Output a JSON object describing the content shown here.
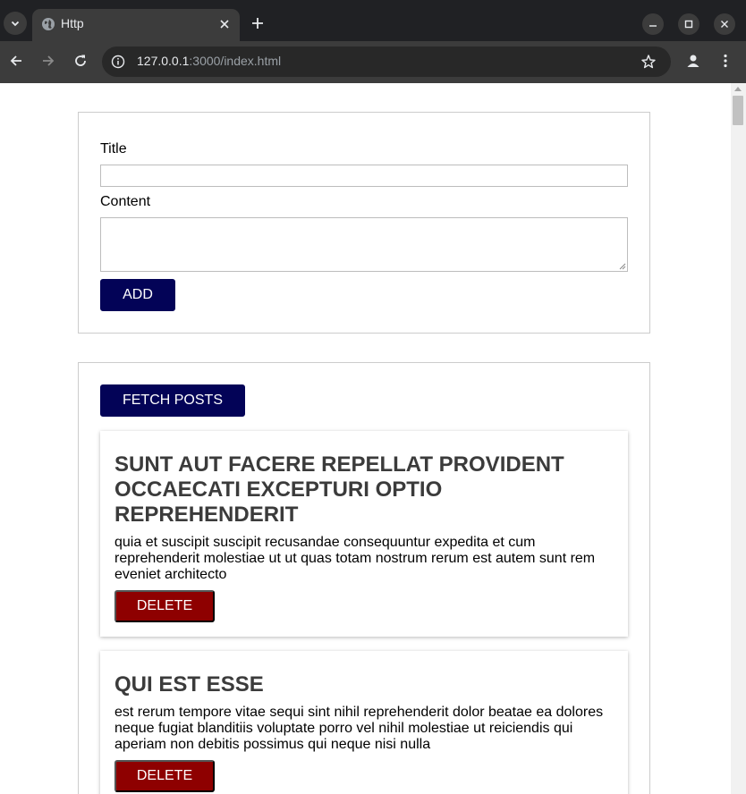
{
  "browser": {
    "tab_title": "Http",
    "url_host": "127.0.0.1",
    "url_rest": ":3000/index.html",
    "icons": [
      "tab-search-icon",
      "globe-icon",
      "close-icon",
      "plus-icon",
      "minimize-icon",
      "maximize-icon",
      "window-close-icon",
      "back-arrow-icon",
      "forward-arrow-icon",
      "reload-icon",
      "info-icon",
      "star-icon",
      "profile-icon",
      "more-vert-icon"
    ]
  },
  "form": {
    "title_label": "Title",
    "title_value": "",
    "content_label": "Content",
    "content_value": "",
    "add_button": "ADD"
  },
  "posts_section": {
    "fetch_button": "FETCH POSTS",
    "posts": [
      {
        "title": "sunt aut facere repellat provident occaecati excepturi optio reprehenderit",
        "body": "quia et suscipit suscipit recusandae consequuntur expedita et cum reprehenderit molestiae ut ut quas totam nostrum rerum est autem sunt rem eveniet architecto",
        "delete_button": "DELETE"
      },
      {
        "title": "qui est esse",
        "body": "est rerum tempore vitae sequi sint nihil reprehenderit dolor beatae ea dolores neque fugiat blanditiis voluptate porro vel nihil molestiae ut reiciendis qui aperiam non debitis possimus qui neque nisi nulla",
        "delete_button": "DELETE"
      }
    ]
  },
  "colors": {
    "primary_button": "#030357",
    "danger_button": "#8e0000",
    "title_text": "#3b3b3b",
    "chrome_dark": "#202124",
    "chrome_toolbar": "#3c3c3c"
  }
}
